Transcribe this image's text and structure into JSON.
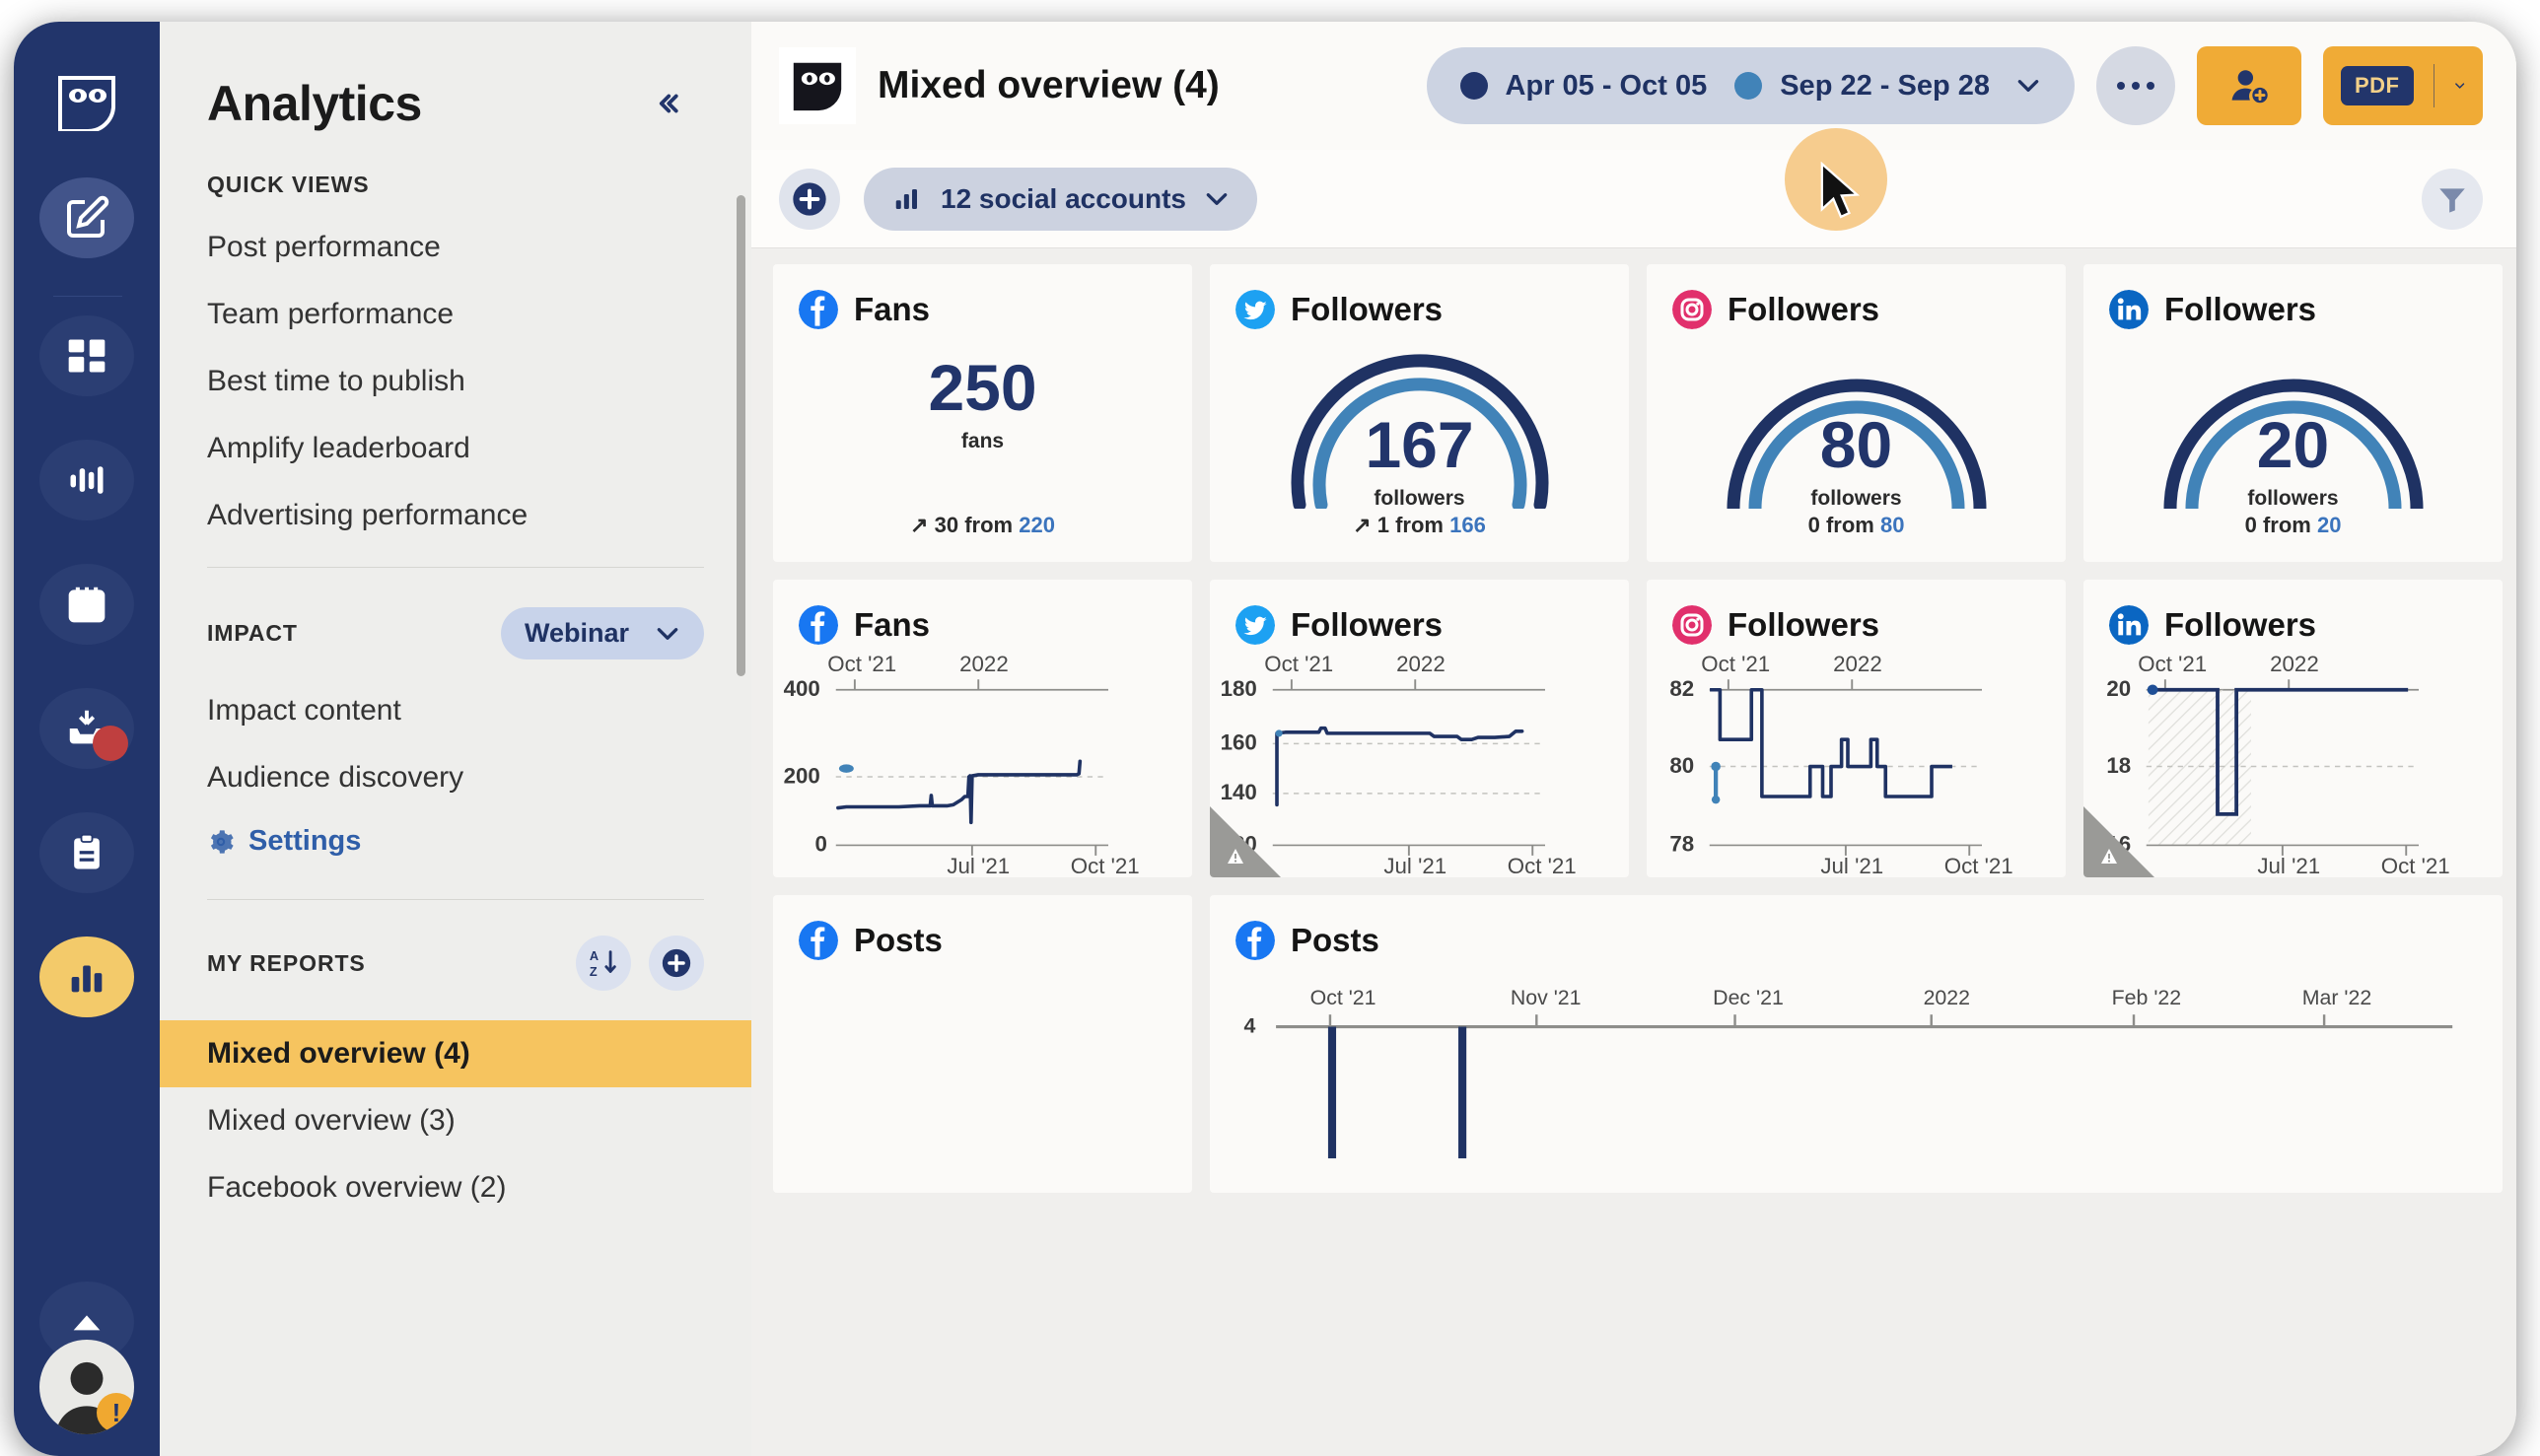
{
  "rail": {
    "logo": "hootsuite-owl-logo",
    "items": [
      {
        "name": "compose-icon",
        "label": "Compose"
      },
      {
        "name": "dashboard-grid-icon",
        "label": "Dashboard"
      },
      {
        "name": "streams-icon",
        "label": "Streams"
      },
      {
        "name": "calendar-icon",
        "label": "Planner"
      },
      {
        "name": "inbox-icon",
        "label": "Inbox"
      },
      {
        "name": "clipboard-icon",
        "label": "Assignments"
      },
      {
        "name": "analytics-bars-icon",
        "label": "Analytics"
      },
      {
        "name": "collapse-up-icon",
        "label": "More"
      }
    ],
    "avatar_warning": "!"
  },
  "sidebar": {
    "title": "Analytics",
    "collapse_icon": "«",
    "quick_views_label": "QUICK VIEWS",
    "quick_views": [
      {
        "label": "Post performance"
      },
      {
        "label": "Team performance"
      },
      {
        "label": "Best time to publish"
      },
      {
        "label": "Amplify leaderboard"
      },
      {
        "label": "Advertising performance"
      }
    ],
    "impact_label": "IMPACT",
    "impact_selector": "Webinar",
    "impact_items": [
      {
        "label": "Impact content"
      },
      {
        "label": "Audience discovery"
      }
    ],
    "settings_label": "Settings",
    "my_reports_label": "MY REPORTS",
    "sort_icon": "A-Z-sort-icon",
    "add_icon": "add-report-icon",
    "reports": [
      {
        "label": "Mixed overview (4)",
        "active": true
      },
      {
        "label": "Mixed overview (3)",
        "active": false
      },
      {
        "label": "Facebook overview (2)",
        "active": false
      }
    ]
  },
  "topbar": {
    "owl_icon": "hootsuite-owl-icon",
    "report_title": "Mixed overview (4)",
    "date_primary": "Apr 05 - Oct 05",
    "date_compare": "Sep 22 - Sep 28",
    "date_primary_color": "#22356b",
    "date_compare_color": "#4183b8",
    "chevron": "⌄",
    "more_label": "•••",
    "share_icon": "add-user-icon",
    "pdf_label": "PDF",
    "export_chevron": "chevron-down-icon",
    "accent_amber": "#f0ab36"
  },
  "filterbar": {
    "add_icon": "add-widget-icon",
    "accounts_icon": "bar-chart-icon",
    "accounts_label": "12 social accounts",
    "accounts_chevron": "chevron-down-icon",
    "filter_icon": "filter-funnel-icon"
  },
  "metric_cards": [
    {
      "network": "facebook",
      "network_color": "#1877f2",
      "title": "Fans",
      "value": "250",
      "unit": "fans",
      "delta_arrow": "↗",
      "delta_value": "30",
      "delta_from": "from",
      "delta_prev": "220",
      "gauge": false
    },
    {
      "network": "twitter",
      "network_color": "#1da1f2",
      "title": "Followers",
      "value": "167",
      "unit": "followers",
      "delta_arrow": "↗",
      "delta_value": "1",
      "delta_from": "from",
      "delta_prev": "166",
      "gauge": true,
      "gauge_pct": 0.93,
      "gauge_prev_pct": 0.92
    },
    {
      "network": "instagram",
      "network_color": "#e1306c",
      "title": "Followers",
      "value": "80",
      "unit": "followers",
      "delta_arrow": "",
      "delta_value": "0",
      "delta_from": "from",
      "delta_prev": "80",
      "gauge": true,
      "gauge_pct": 0.97,
      "gauge_prev_pct": 0.97
    },
    {
      "network": "linkedin",
      "network_color": "#0a66c2",
      "title": "Followers",
      "value": "20",
      "unit": "followers",
      "delta_arrow": "",
      "delta_value": "0",
      "delta_from": "from",
      "delta_prev": "20",
      "gauge": true,
      "gauge_pct": 0.97,
      "gauge_prev_pct": 0.97
    }
  ],
  "chart_data": [
    {
      "type": "line",
      "network": "facebook",
      "title": "Fans",
      "ylabel": "",
      "xlabel": "",
      "yticks": [
        "400",
        "200",
        "0"
      ],
      "ylim": [
        0,
        400
      ],
      "xticks_top": [
        "Oct '21",
        "2022"
      ],
      "xticks_bottom": [
        "Jul '21",
        "Oct '21"
      ],
      "grid": true,
      "warning": false,
      "x": [
        0,
        4,
        10,
        18,
        26,
        34,
        42,
        50,
        55,
        57,
        59,
        63,
        66,
        68,
        70,
        71,
        72,
        73,
        74,
        78,
        84,
        90,
        95,
        97,
        98,
        100
      ],
      "values": [
        160,
        161,
        162,
        162,
        163,
        163,
        164,
        164,
        185,
        165,
        165,
        166,
        168,
        175,
        182,
        215,
        120,
        215,
        216,
        216,
        216,
        216,
        216,
        216,
        216,
        250
      ]
    },
    {
      "type": "line",
      "network": "twitter",
      "title": "Followers",
      "ylabel": "",
      "xlabel": "",
      "yticks": [
        "180",
        "160",
        "140",
        "120"
      ],
      "ylim": [
        120,
        180
      ],
      "xticks_top": [
        "Oct '21",
        "2022"
      ],
      "xticks_bottom": [
        "Jul '21",
        "Oct '21"
      ],
      "grid": true,
      "warning": true,
      "x": [
        3,
        3,
        4,
        6,
        12,
        20,
        24,
        26,
        28,
        30,
        34,
        44,
        56,
        62,
        66,
        70,
        74,
        78,
        82,
        86,
        90,
        94,
        97,
        99
      ],
      "values": [
        133,
        166,
        167,
        167,
        167,
        167,
        169,
        167,
        170,
        166,
        167,
        167,
        167,
        166,
        165,
        165,
        164,
        165,
        166,
        166,
        166,
        167,
        168,
        169
      ]
    },
    {
      "type": "line",
      "network": "instagram",
      "title": "Followers",
      "ylabel": "",
      "xlabel": "",
      "yticks": [
        "82",
        "80",
        "78"
      ],
      "ylim": [
        78,
        82
      ],
      "xticks_top": [
        "Oct '21",
        "2022"
      ],
      "xticks_bottom": [
        "Jul '21",
        "Oct '21"
      ],
      "grid": true,
      "warning": false,
      "x": [
        2,
        4,
        4,
        12,
        12,
        19,
        19,
        22,
        22,
        40,
        40,
        46,
        46,
        49,
        49,
        53,
        53,
        56,
        56,
        60,
        60,
        63,
        63,
        67,
        67,
        72,
        72,
        76,
        76,
        86,
        86,
        90,
        90,
        97,
        100
      ],
      "values": [
        82,
        82,
        81,
        81,
        82,
        82,
        80.4,
        80.4,
        79.4,
        79.4,
        80,
        80,
        79.4,
        79.4,
        80,
        80,
        81,
        81,
        80,
        80,
        81,
        81,
        80,
        80,
        79.4,
        79.4,
        80,
        80,
        79.4,
        79.4,
        80,
        80,
        79.4,
        79.4,
        80
      ]
    },
    {
      "type": "line",
      "network": "linkedin",
      "title": "Followers",
      "ylabel": "",
      "xlabel": "",
      "yticks": [
        "20",
        "18",
        "16"
      ],
      "ylim": [
        16,
        20
      ],
      "xticks_top": [
        "Oct '21",
        "2022"
      ],
      "xticks_bottom": [
        "Jul '21",
        "Oct '21"
      ],
      "grid": true,
      "warning": true,
      "hatched_region": true,
      "x": [
        2,
        26,
        26,
        31,
        31,
        100
      ],
      "values": [
        20,
        20,
        16.9,
        16.9,
        20,
        20
      ]
    },
    {
      "type": "bar",
      "network": "facebook",
      "title": "Posts",
      "ylabel": "",
      "xlabel": "",
      "yticks": [
        "4"
      ],
      "ylim": [
        0,
        4
      ],
      "xticks_bottom": [
        "Oct '21",
        "Nov '21",
        "Dec '21",
        "2022",
        "Feb '22",
        "Mar '22"
      ],
      "grid": false,
      "warning": false,
      "x": [
        7,
        15
      ],
      "values": [
        4,
        4
      ]
    }
  ],
  "posts_card_empty": {
    "network": "facebook",
    "title": "Posts"
  }
}
